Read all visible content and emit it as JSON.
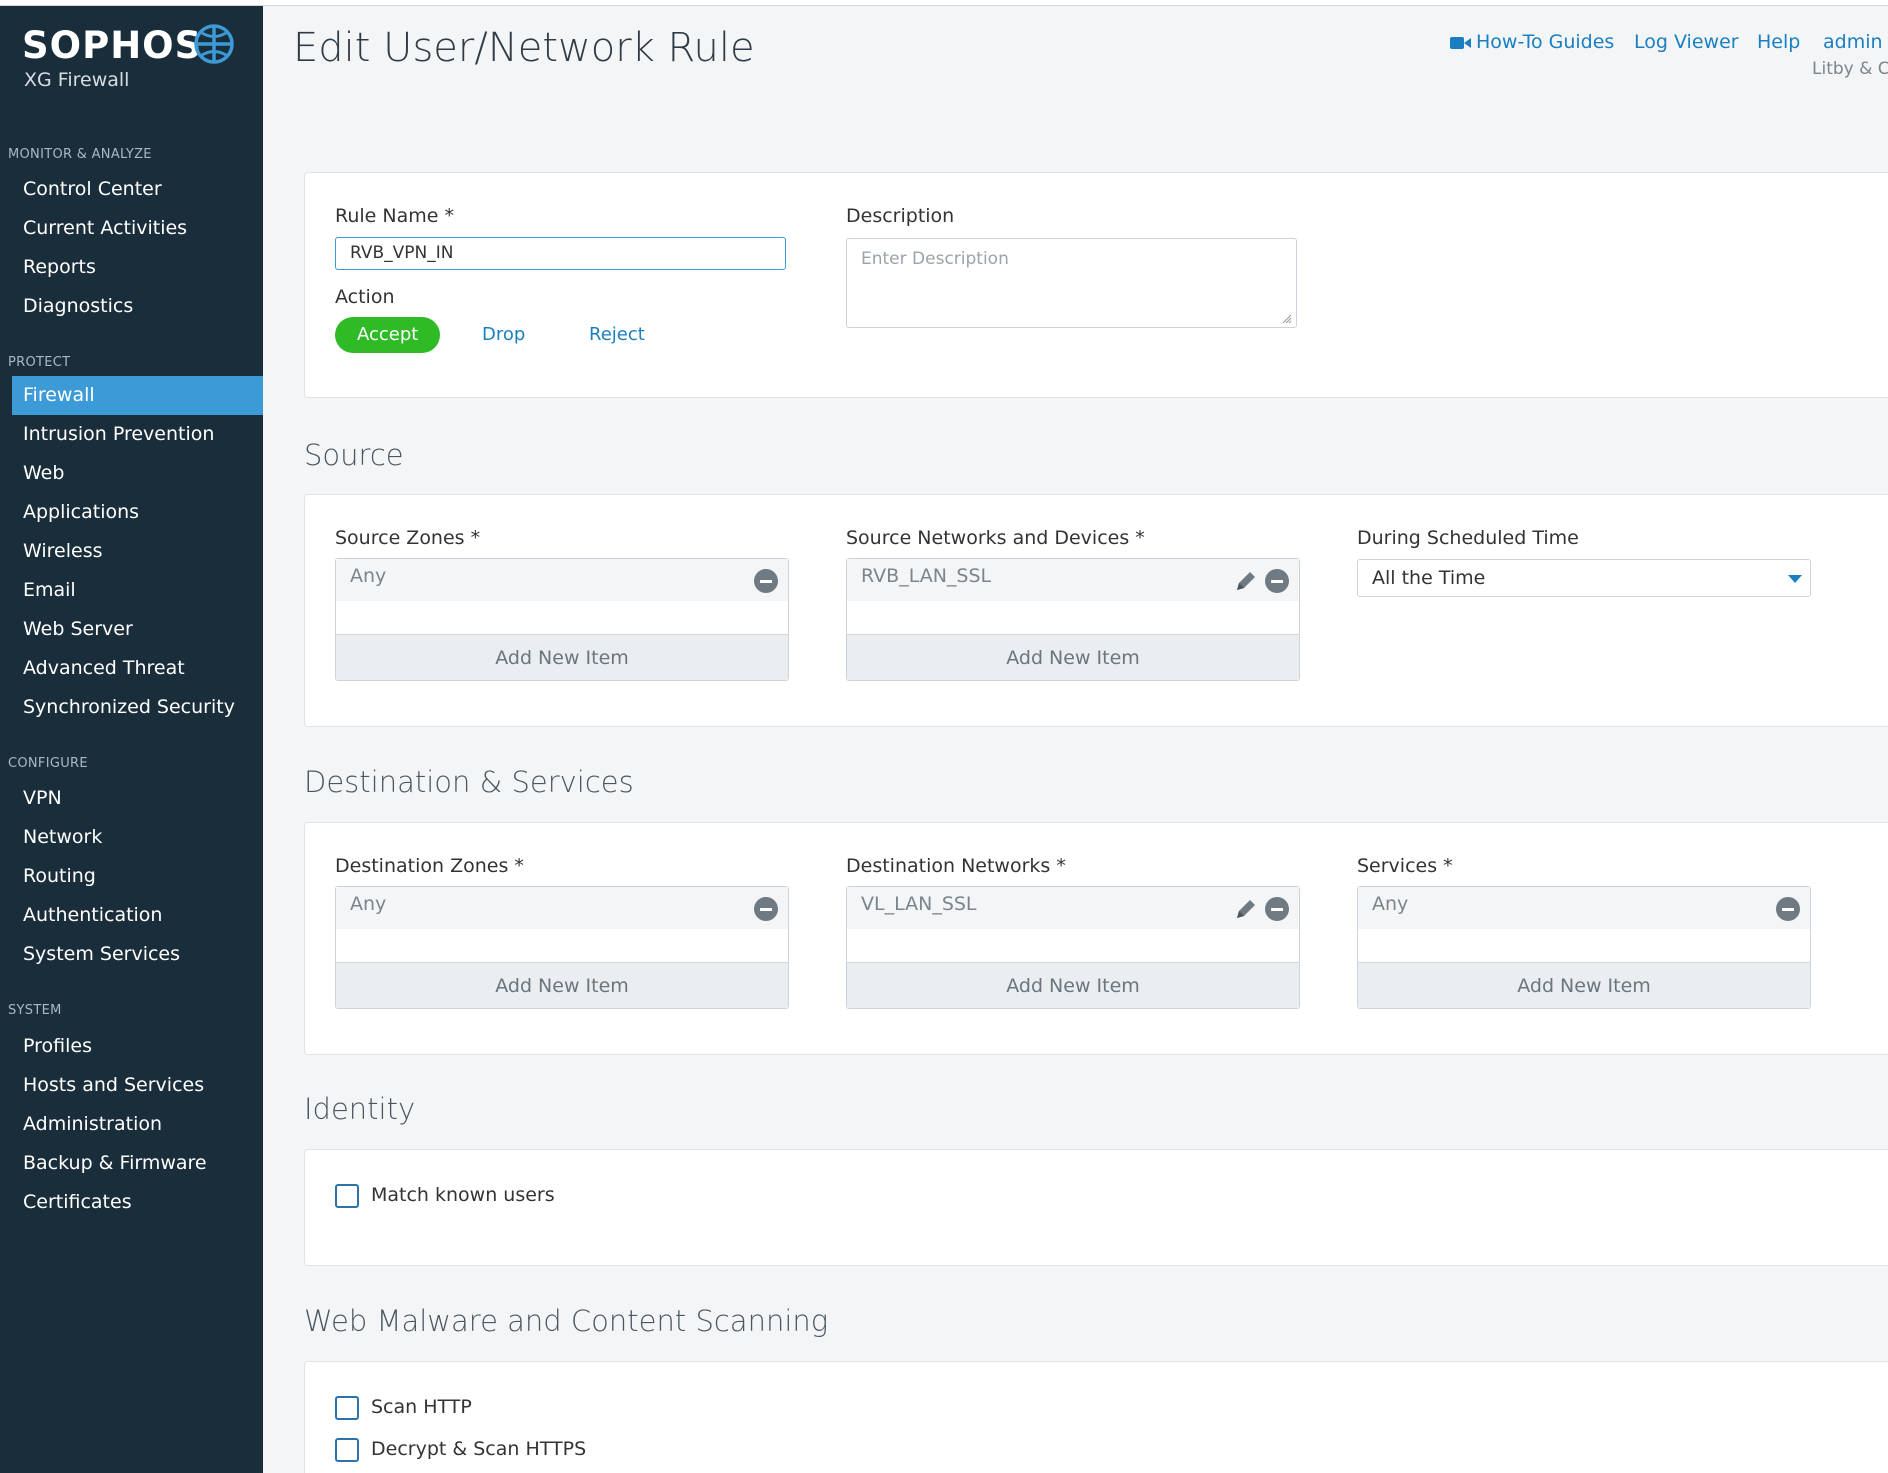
{
  "brand": {
    "name": "SOPHOS",
    "product": "XG Firewall"
  },
  "sidebar": {
    "sections": [
      {
        "title": "MONITOR & ANALYZE",
        "items": [
          "Control Center",
          "Current Activities",
          "Reports",
          "Diagnostics"
        ]
      },
      {
        "title": "PROTECT",
        "items": [
          "Firewall",
          "Intrusion Prevention",
          "Web",
          "Applications",
          "Wireless",
          "Email",
          "Web Server",
          "Advanced Threat",
          "Synchronized Security"
        ]
      },
      {
        "title": "CONFIGURE",
        "items": [
          "VPN",
          "Network",
          "Routing",
          "Authentication",
          "System Services"
        ]
      },
      {
        "title": "SYSTEM",
        "items": [
          "Profiles",
          "Hosts and Services",
          "Administration",
          "Backup & Firmware",
          "Certificates"
        ]
      }
    ],
    "active_item": "Firewall"
  },
  "header": {
    "title": "Edit User/Network Rule",
    "links": {
      "howto": "How-To Guides",
      "logviewer": "Log Viewer",
      "help": "Help",
      "user": "admin"
    },
    "org": "Litby & Co"
  },
  "rule": {
    "name_label": "Rule Name *",
    "name_value": "RVB_VPN_IN",
    "description_label": "Description",
    "description_placeholder": "Enter Description",
    "action_label": "Action",
    "actions": {
      "accept": "Accept",
      "drop": "Drop",
      "reject": "Reject"
    },
    "selected_action": "Accept"
  },
  "source": {
    "title": "Source",
    "zones_label": "Source Zones *",
    "zones_value": "Any",
    "networks_label": "Source Networks and Devices *",
    "networks_value": "RVB_LAN_SSL",
    "schedule_label": "During Scheduled Time",
    "schedule_value": "All the Time",
    "add_label": "Add New Item"
  },
  "destination": {
    "title": "Destination & Services",
    "zones_label": "Destination Zones *",
    "zones_value": "Any",
    "networks_label": "Destination Networks *",
    "networks_value": "VL_LAN_SSL",
    "services_label": "Services *",
    "services_value": "Any",
    "add_label": "Add New Item"
  },
  "identity": {
    "title": "Identity",
    "match_known_users": "Match known users",
    "match_known_users_checked": false
  },
  "scanning": {
    "title": "Web Malware and Content Scanning",
    "scan_http": "Scan HTTP",
    "scan_http_checked": false,
    "scan_https": "Decrypt & Scan HTTPS",
    "scan_https_checked": false
  },
  "colors": {
    "sidebar_bg": "#1a2d3a",
    "active_nav": "#3c9ad7",
    "accept_green": "#2ebb26",
    "link_blue": "#1a7fc1"
  }
}
